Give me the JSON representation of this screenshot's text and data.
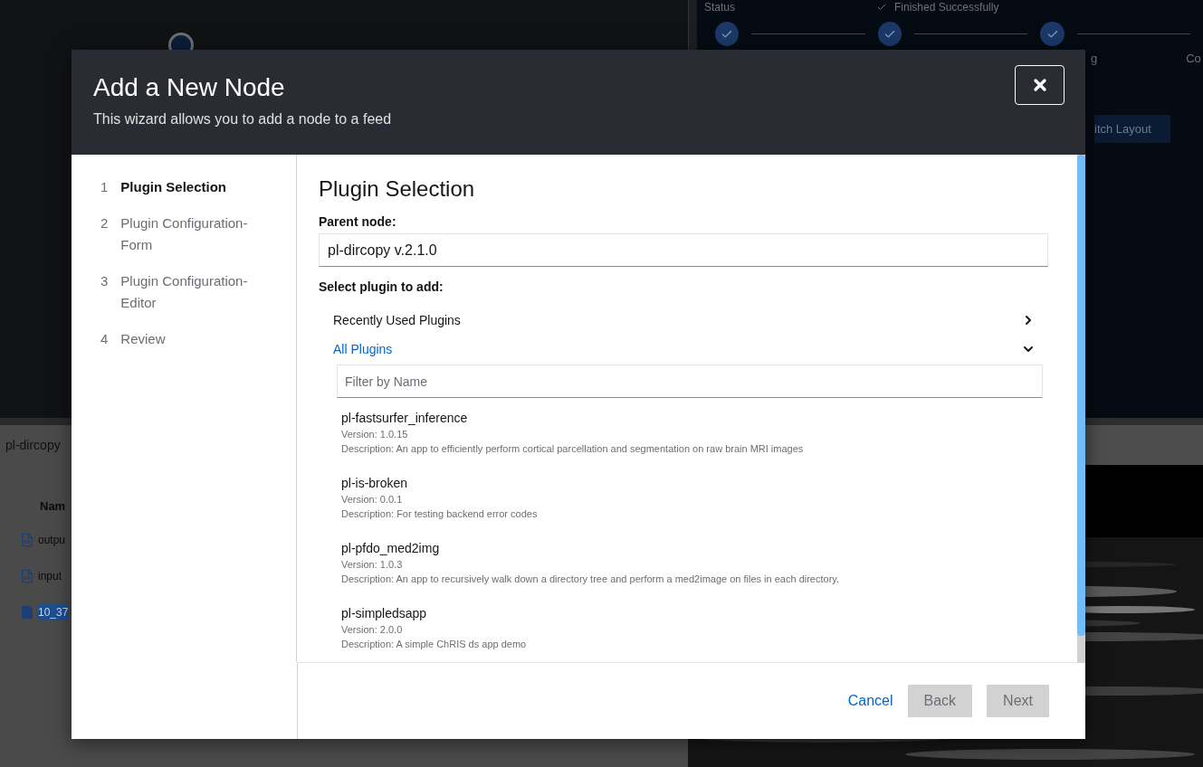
{
  "background": {
    "status_label": "Status",
    "status_value": "Finished Successfully",
    "steps": [
      {
        "done": true
      },
      {
        "done": true
      },
      {
        "done": true
      }
    ],
    "step_labels": [
      "g",
      "Co"
    ],
    "layout_button": "itch Layout",
    "file_panel_title": "pl-dircopy",
    "column_header": "Nam",
    "files": [
      {
        "name": "outpu",
        "kind": "code",
        "selected": false
      },
      {
        "name": "input",
        "kind": "code",
        "selected": false
      },
      {
        "name": "10_37",
        "kind": "file",
        "selected": true
      }
    ]
  },
  "modal": {
    "title": "Add a New Node",
    "subtitle": "This wizard allows you to add a node to a feed",
    "nav": [
      {
        "number": "1",
        "label": "Plugin Selection",
        "selected": true
      },
      {
        "number": "2",
        "label": "Plugin Configuration-Form",
        "selected": false
      },
      {
        "number": "3",
        "label": "Plugin Configuration-Editor",
        "selected": false
      },
      {
        "number": "4",
        "label": "Review",
        "selected": false
      }
    ],
    "heading": "Plugin Selection",
    "parent_label": "Parent node:",
    "parent_value": "pl-dircopy v.2.1.0",
    "select_label": "Select plugin to add:",
    "sections": [
      {
        "label": "Recently Used Plugins",
        "expanded": false
      },
      {
        "label": "All Plugins",
        "expanded": true
      }
    ],
    "filter": {
      "placeholder": "Filter by Name"
    },
    "plugins": [
      {
        "name": "pl-fastsurfer_inference",
        "version": "Version: 1.0.15",
        "description": "Description: An app to efficiently perform cortical parcellation and segmentation on raw brain MRI images"
      },
      {
        "name": "pl-is-broken",
        "version": "Version: 0.0.1",
        "description": "Description: For testing backend error codes"
      },
      {
        "name": "pl-pfdo_med2img",
        "version": "Version: 1.0.3",
        "description": "Description: An app to recursively walk down a directory tree and perform a med2image on files in each directory."
      },
      {
        "name": "pl-simpledsapp",
        "version": "Version: 2.0.0",
        "description": "Description: A simple ChRIS ds app demo"
      }
    ],
    "footer": [
      {
        "label": "Cancel",
        "kind": "link",
        "disabled": false
      },
      {
        "label": "Back",
        "kind": "button",
        "disabled": true
      },
      {
        "label": "Next",
        "kind": "button",
        "disabled": true
      }
    ]
  }
}
